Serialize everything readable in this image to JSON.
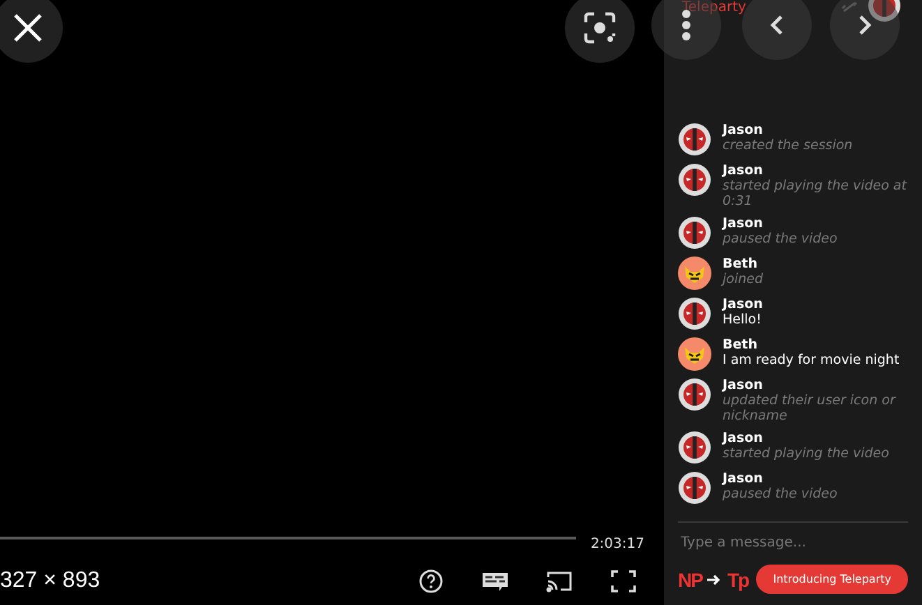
{
  "overlay_buttons": [
    {
      "kind": "close"
    },
    {
      "kind": "lens"
    },
    {
      "kind": "more"
    },
    {
      "kind": "prev"
    },
    {
      "kind": "next"
    }
  ],
  "player": {
    "duration": "2:03:17",
    "dimensions": "327 × 893",
    "controls": [
      {
        "kind": "help"
      },
      {
        "kind": "captions"
      },
      {
        "kind": "cast"
      },
      {
        "kind": "fullscreen"
      }
    ]
  },
  "chat": {
    "brand": "Teleparty",
    "messages": [
      {
        "name": "Jason",
        "avatar": {
          "kind": "mask"
        },
        "kind": "system",
        "text": "created the session"
      },
      {
        "name": "Jason",
        "avatar": {
          "kind": "mask"
        },
        "kind": "system",
        "text": "started playing the video at 0:31"
      },
      {
        "name": "Jason",
        "avatar": {
          "kind": "mask"
        },
        "kind": "system",
        "text": "paused the video"
      },
      {
        "name": "Beth",
        "avatar": {
          "kind": "hero"
        },
        "kind": "system",
        "text": "joined"
      },
      {
        "name": "Jason",
        "avatar": {
          "kind": "mask"
        },
        "kind": "chat",
        "text": "Hello!"
      },
      {
        "name": "Beth",
        "avatar": {
          "kind": "hero"
        },
        "kind": "chat",
        "text": "I am ready for movie night"
      },
      {
        "name": "Jason",
        "avatar": {
          "kind": "mask"
        },
        "kind": "system",
        "text": "updated their user icon or nickname"
      },
      {
        "name": "Jason",
        "avatar": {
          "kind": "mask"
        },
        "kind": "system",
        "text": "started playing the video"
      },
      {
        "name": "Jason",
        "avatar": {
          "kind": "mask"
        },
        "kind": "system",
        "text": "paused the video"
      }
    ],
    "input": {
      "placeholder": "Type a message..."
    },
    "footer": {
      "old_logo": "NP",
      "new_logo": "Tp",
      "button": "Introducing Teleparty"
    }
  }
}
